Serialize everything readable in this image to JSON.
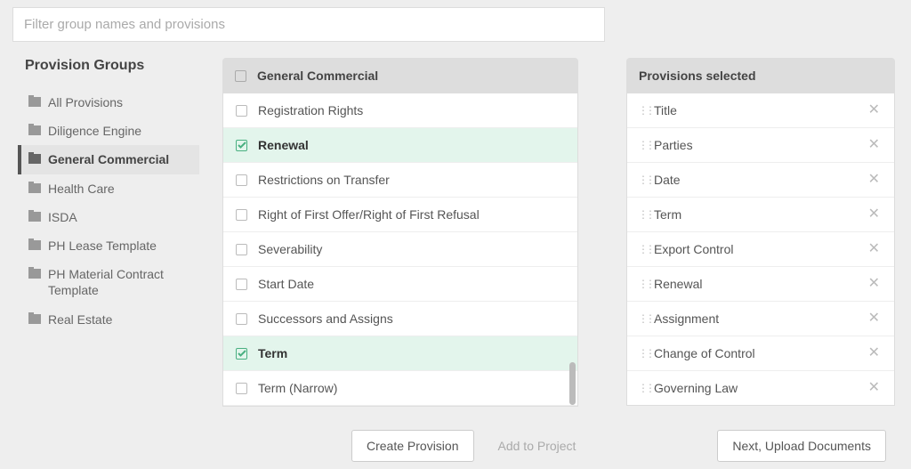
{
  "search": {
    "placeholder": "Filter group names and provisions"
  },
  "sidebar": {
    "title": "Provision Groups",
    "groups": [
      {
        "label": "All Provisions",
        "active": false
      },
      {
        "label": "Diligence Engine",
        "active": false
      },
      {
        "label": "General Commercial",
        "active": true
      },
      {
        "label": "Health Care",
        "active": false
      },
      {
        "label": "ISDA",
        "active": false
      },
      {
        "label": "PH Lease Template",
        "active": false
      },
      {
        "label": "PH Material Contract Template",
        "active": false
      },
      {
        "label": "Real Estate",
        "active": false
      }
    ]
  },
  "provisions": {
    "header": "General Commercial",
    "items": [
      {
        "label": "Registration Rights",
        "checked": false
      },
      {
        "label": "Renewal",
        "checked": true
      },
      {
        "label": "Restrictions on Transfer",
        "checked": false
      },
      {
        "label": "Right of First Offer/Right of First Refusal",
        "checked": false
      },
      {
        "label": "Severability",
        "checked": false
      },
      {
        "label": "Start Date",
        "checked": false
      },
      {
        "label": "Successors and Assigns",
        "checked": false
      },
      {
        "label": "Term",
        "checked": true
      },
      {
        "label": "Term (Narrow)",
        "checked": false
      }
    ]
  },
  "selected": {
    "header": "Provisions selected",
    "items": [
      {
        "label": "Title"
      },
      {
        "label": "Parties"
      },
      {
        "label": "Date"
      },
      {
        "label": "Term"
      },
      {
        "label": "Export Control"
      },
      {
        "label": "Renewal"
      },
      {
        "label": "Assignment"
      },
      {
        "label": "Change of Control"
      },
      {
        "label": "Governing Law"
      }
    ]
  },
  "footer": {
    "create": "Create Provision",
    "add": "Add to Project",
    "next": "Next, Upload Documents"
  }
}
